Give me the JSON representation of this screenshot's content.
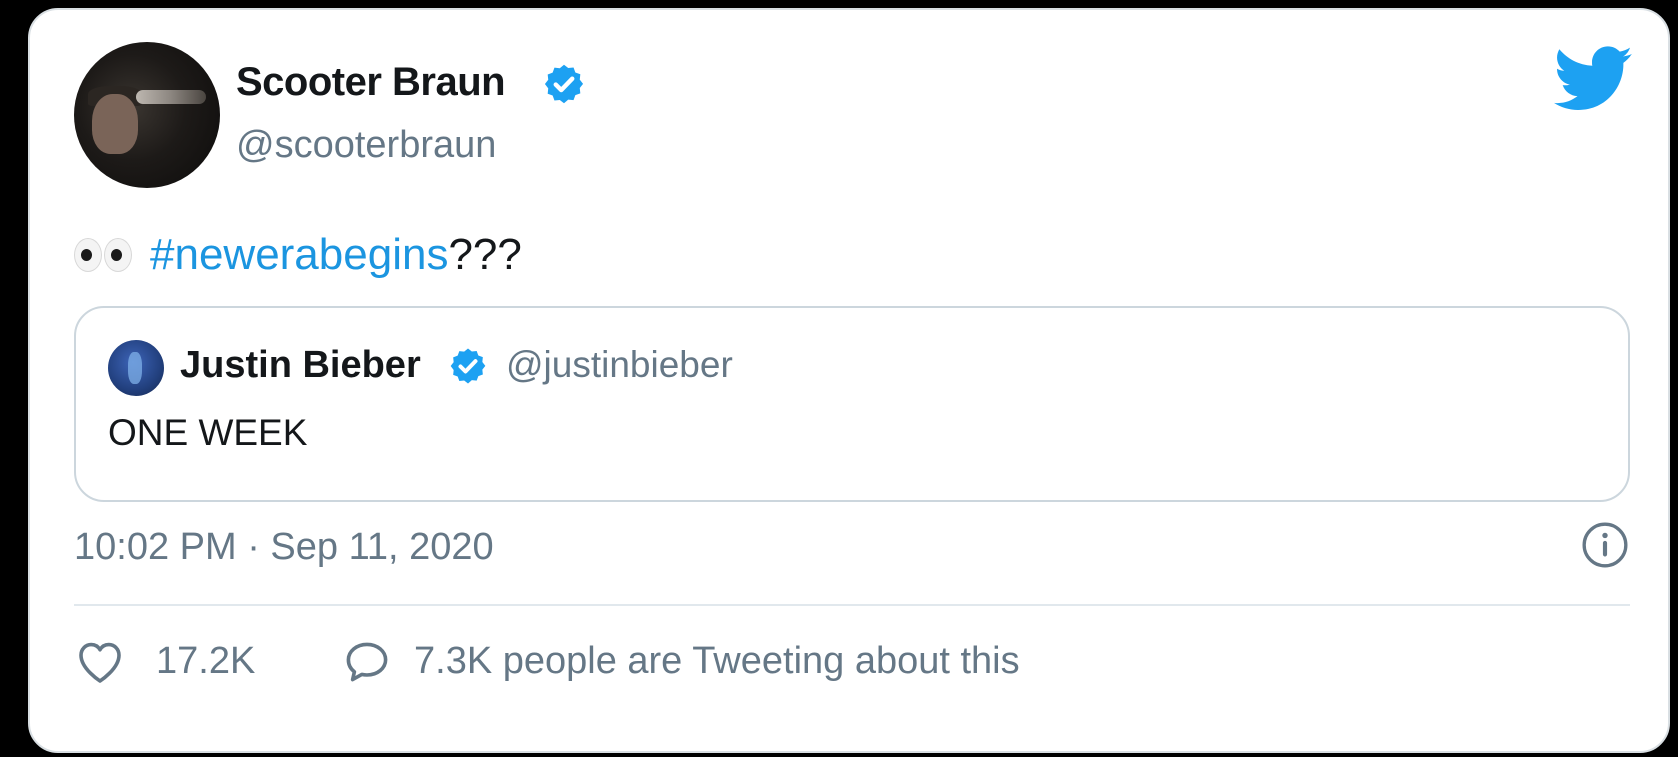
{
  "colors": {
    "hashtag": "#1b95e0",
    "verified": "#1da1f2",
    "text_primary": "#14171a",
    "text_secondary": "#657786",
    "border": "#ccd6dd"
  },
  "tweet": {
    "author_name": "Scooter Braun",
    "author_handle": "@scooterbraun",
    "author_verified": true,
    "logo_icon": "twitter-bird-icon",
    "text_emoji": "eyes-emoji",
    "text_hashtag": "#newerabegins",
    "text_suffix": "???",
    "timestamp": "10:02 PM · Sep 11, 2020",
    "likes": "17.2K",
    "tweeting_text": "7.3K people are Tweeting about this"
  },
  "quote": {
    "author_name": "Justin Bieber",
    "author_handle": "@justinbieber",
    "author_verified": true,
    "text": "ONE WEEK"
  }
}
